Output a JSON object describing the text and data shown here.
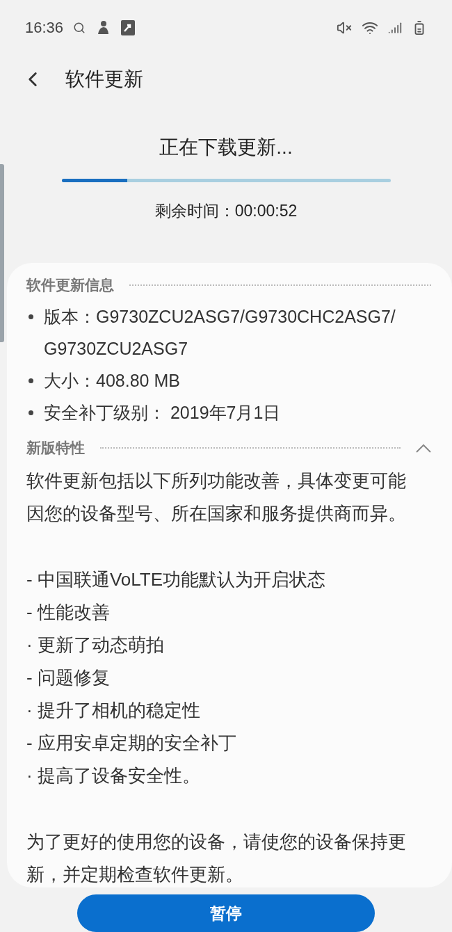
{
  "status_bar": {
    "time": "16:36"
  },
  "header": {
    "title": "软件更新"
  },
  "download": {
    "status": "正在下载更新...",
    "level": 0.2,
    "remaining": "剩余时间：00:00:52"
  },
  "info": {
    "heading": "软件更新信息",
    "items": [
      "版本：G9730ZCU2ASG7/G9730CHC2ASG7/G9730ZCU2ASG7",
      "大小：408.80 MB",
      "安全补丁级别： 2019年7月1日"
    ]
  },
  "features": {
    "heading": "新版特性",
    "expanded": true,
    "intro": "软件更新包括以下所列功能改善，具体变更可能因您的设备型号、所在国家和服务提供商而异。",
    "items": [
      "- 中国联通VoLTE功能默认为开启状态",
      "- 性能改善",
      "· 更新了动态萌拍",
      "- 问题修复",
      "· 提升了相机的稳定性",
      "- 应用安卓定期的安全补丁",
      "· 提高了设备安全性。"
    ],
    "outro": "为了更好的使用您的设备，请使您的设备保持更新，并定期检查软件更新。"
  },
  "button": {
    "label": "暂停"
  }
}
